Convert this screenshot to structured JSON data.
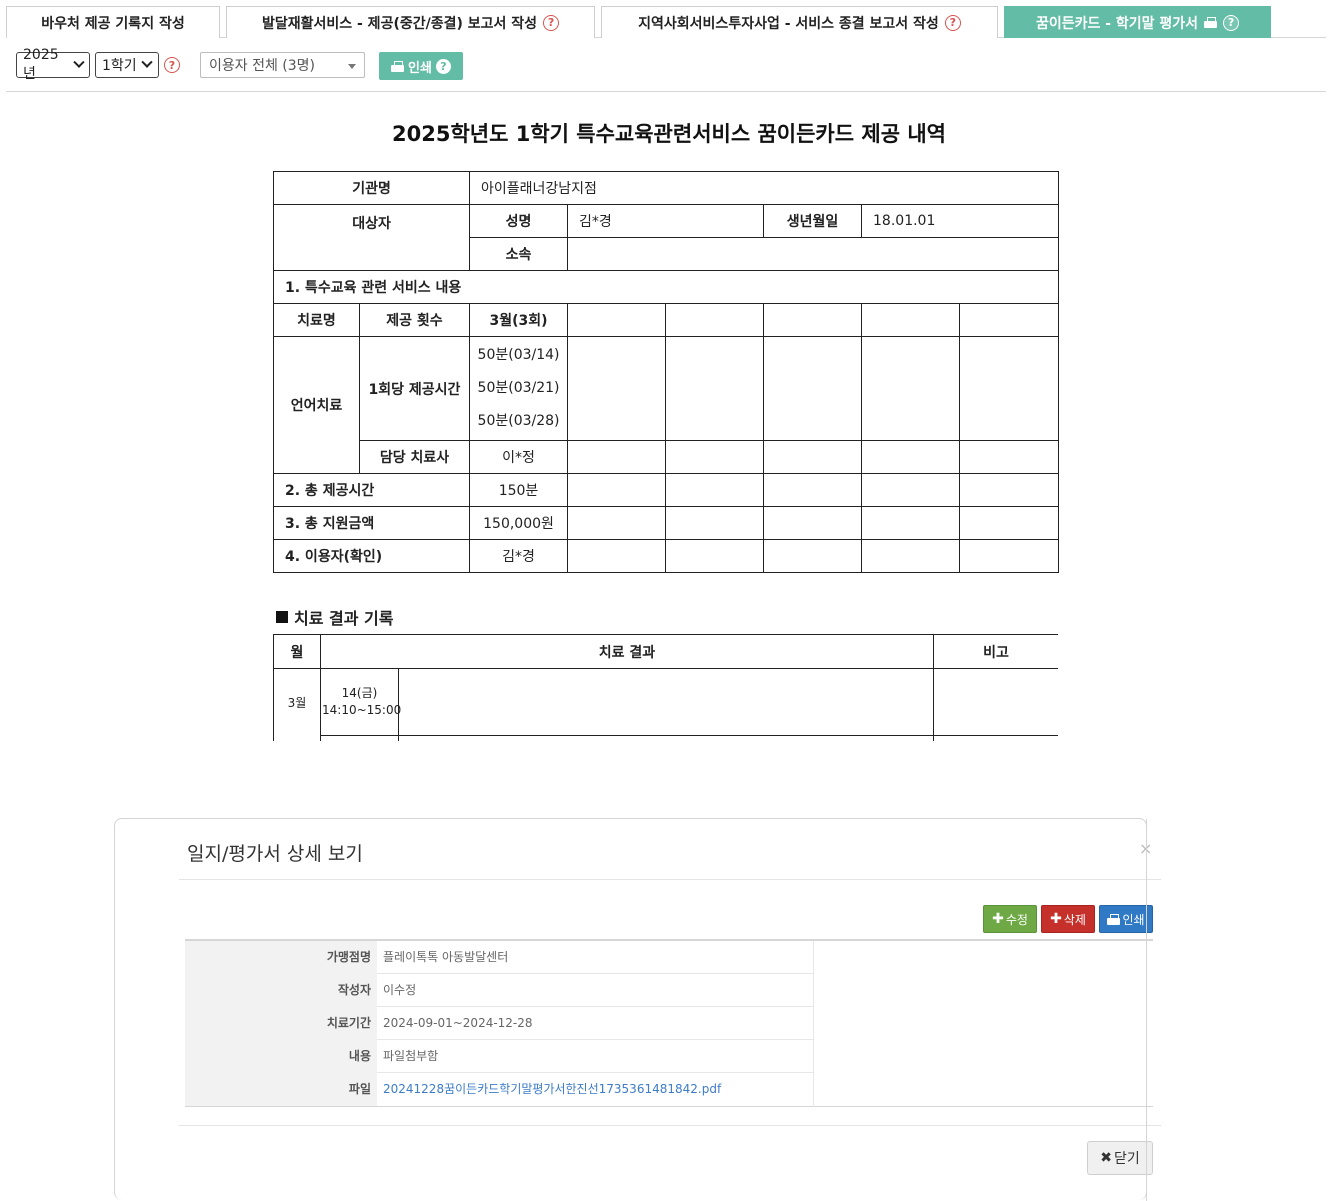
{
  "tabs": [
    {
      "label": "바우처 제공 기록지 작성"
    },
    {
      "label": "발달재활서비스 - 제공(중간/종결) 보고서 작성"
    },
    {
      "label": "지역사회서비스투자사업 - 서비스 종결 보고서 작성"
    },
    {
      "label": "꿈이든카드 - 학기말 평가서"
    }
  ],
  "toolbar": {
    "year": "2025년",
    "semester": "1학기",
    "user_filter": "이용자 전체 (3명)",
    "print_label": "인쇄",
    "help": "?"
  },
  "doc": {
    "title": "2025학년도 1학기 특수교육관련서비스 꿈이든카드 제공 내역",
    "org_label": "기관명",
    "org_value": "아이플래너강남지점",
    "target_label": "대상자",
    "name_label": "성명",
    "name_value": "김*경",
    "birth_label": "생년월일",
    "birth_value": "18.01.01",
    "affil_label": "소속",
    "affil_value": "",
    "sec1": "1. 특수교육 관련 서비스 내용",
    "therapy_label": "치료명",
    "count_label": "제공 횟수",
    "month_header": "3월(3회)",
    "therapy_name": "언어치료",
    "per_session_label": "1회당 제공시간",
    "sessions": [
      "50분(03/14)",
      "50분(03/21)",
      "50분(03/28)"
    ],
    "therapist_label": "담당 치료사",
    "therapist_value": "이*정",
    "sec2": "2. 총 제공시간",
    "sec2_value": "150분",
    "sec3": "3. 총 지원금액",
    "sec3_value": "150,000원",
    "sec4": "4. 이용자(확인)",
    "sec4_value": "김*경"
  },
  "results": {
    "title": "치료 결과 기록",
    "col_month": "월",
    "col_result": "치료 결과",
    "col_note": "비고",
    "row_month": "3월",
    "row_date": "14(금)",
    "row_time": "14:10~15:00"
  },
  "modal": {
    "title": "일지/평가서 상세 보기",
    "close_x": "×",
    "edit_label": "수정",
    "delete_label": "삭제",
    "print_label": "인쇄",
    "rows": [
      {
        "k": "가맹점명",
        "v": "플레이톡톡 아동발달센터"
      },
      {
        "k": "작성자",
        "v": "이수정"
      },
      {
        "k": "치료기간",
        "v": "2024-09-01~2024-12-28"
      },
      {
        "k": "내용",
        "v": "파일첨부함"
      },
      {
        "k": "파일",
        "v": "20241228꿈이든카드학기말평가서한진선1735361481842.pdf"
      }
    ],
    "close_label": "닫기"
  }
}
